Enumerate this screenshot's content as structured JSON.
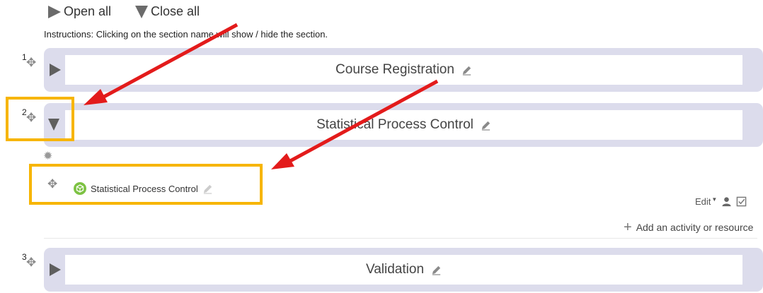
{
  "toolbar": {
    "open_all_label": "Open all",
    "close_all_label": "Close all"
  },
  "instructions": "Instructions: Clicking on the section name will show / hide the section.",
  "sections": [
    {
      "number": "1",
      "title": "Course Registration",
      "expanded": false
    },
    {
      "number": "2",
      "title": "Statistical Process Control",
      "expanded": true
    },
    {
      "number": "3",
      "title": "Validation",
      "expanded": false
    }
  ],
  "section2_content": {
    "activity_label": "Statistical Process Control",
    "edit_menu_label": "Edit",
    "add_activity_label": "Add an activity or resource"
  },
  "colors": {
    "section_band": "#dcdcec",
    "highlight": "#f7b500",
    "arrow": "#e31b1b",
    "activity_icon": "#7dc243"
  }
}
